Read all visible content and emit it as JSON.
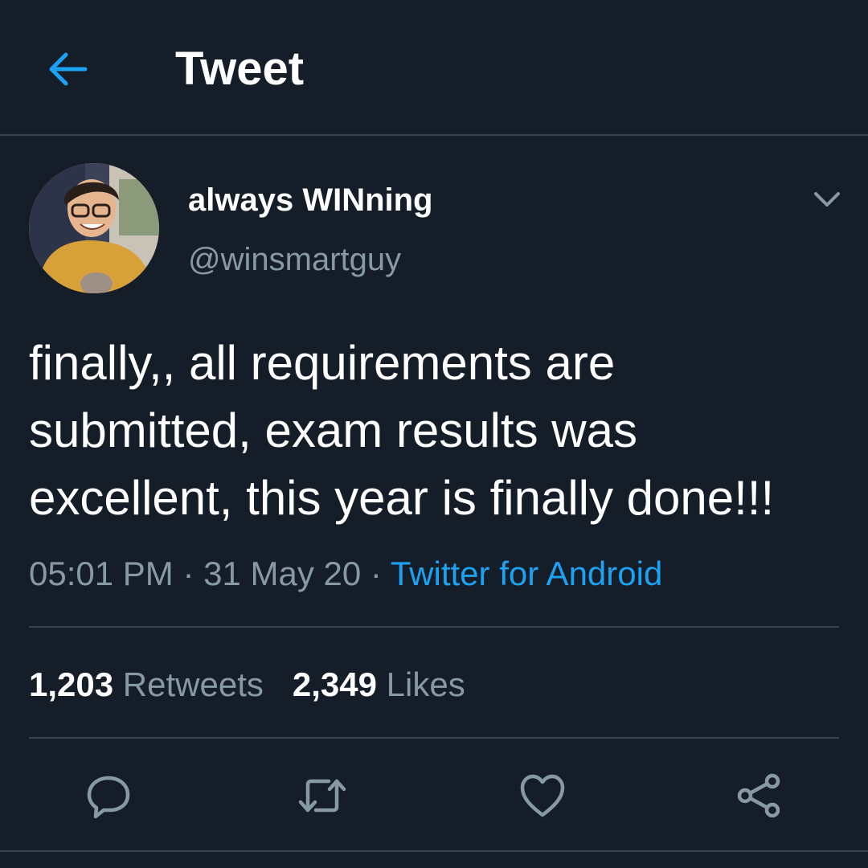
{
  "header": {
    "title": "Tweet",
    "back_icon": "arrow-left-icon",
    "accent": "#1da1f2"
  },
  "tweet": {
    "author": {
      "display_name": "always WINning",
      "handle": "@winsmartguy"
    },
    "text": "finally,, all requirements are submitted, exam results was excellent, this year is finally done!!!",
    "time": "05:01 PM",
    "separator": "·",
    "date": "31 May 20",
    "source": "Twitter for Android",
    "stats": {
      "retweets_count": "1,203",
      "retweets_label": "Retweets",
      "likes_count": "2,349",
      "likes_label": "Likes"
    }
  },
  "actions": [
    "reply-icon",
    "retweet-icon",
    "like-icon",
    "share-icon"
  ],
  "colors": {
    "background": "#151d28",
    "secondary_text": "#8899a6",
    "divider": "#38444d",
    "link": "#1da1f2"
  }
}
